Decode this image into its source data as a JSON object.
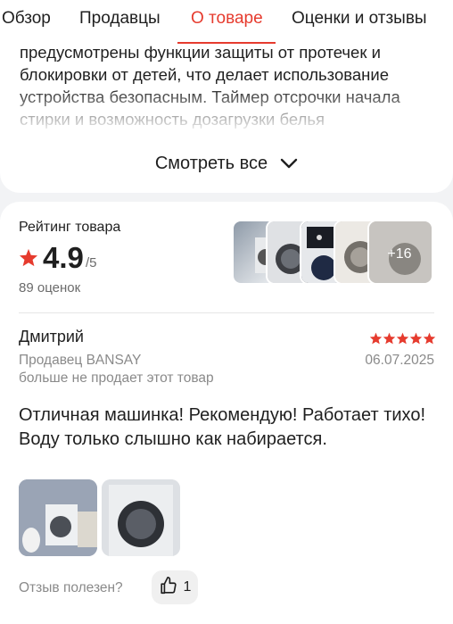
{
  "tabs": [
    {
      "label": "Обзор"
    },
    {
      "label": "Продавцы"
    },
    {
      "label": "О товаре",
      "active": true
    },
    {
      "label": "Оценки и отзывы"
    }
  ],
  "description": {
    "text": "предусмотрены функции защиты от протечек и блокировки от детей, что делает использование устройства безопасным. Таймер отсрочки начала стирки и возможность дозагрузки белья"
  },
  "see_all": {
    "label": "Смотреть все",
    "icon": "chevron-down-icon"
  },
  "rating": {
    "label": "Рейтинг товара",
    "value": "4.9",
    "max": "/5",
    "count": "89 оценок",
    "more_photos": "+16"
  },
  "review": {
    "author": "Дмитрий",
    "stars": 5,
    "seller": "Продавец BANSAY",
    "date": "06.07.2025",
    "seller_note": "больше не продает этот товар",
    "text": "Отличная машинка! Рекомендую! Работает тихо! Воду только слышно как набирается.",
    "helpful_question": "Отзыв полезен?",
    "helpful_count": "1"
  },
  "colors": {
    "accent": "#e63b2e",
    "text": "#1f1f1f",
    "muted": "#8a8a8a",
    "background": "#f2f3f5"
  }
}
